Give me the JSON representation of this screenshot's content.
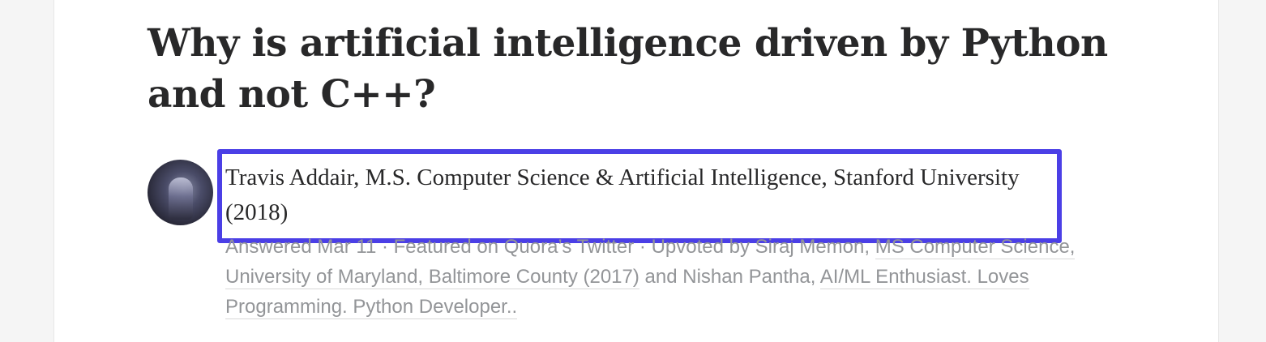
{
  "question": {
    "title": "Why is artificial intelligence driven by Python and not C++?"
  },
  "answer": {
    "author_credential": "Travis Addair, M.S. Computer Science & Artificial Intelligence, Stanford University (2018)",
    "meta": {
      "answered": "Answered Mar 11",
      "separator_1": " · ",
      "featured": "Featured on Quora’s Twitter",
      "separator_2": " · ",
      "upvoted_prefix": "Upvoted by Siraj Memon, ",
      "upvoter_1_credential": "MS Computer Science, University of Maryland, Baltimore County (2017)",
      "upvoted_conjunction": " and Nishan Pantha, ",
      "upvoter_2_credential": "AI/ML Enthusiast. Loves Programming. Python Developer.."
    }
  },
  "colors": {
    "highlight_border": "#4b3fe6",
    "title_text": "#282829",
    "meta_text": "#939598"
  }
}
